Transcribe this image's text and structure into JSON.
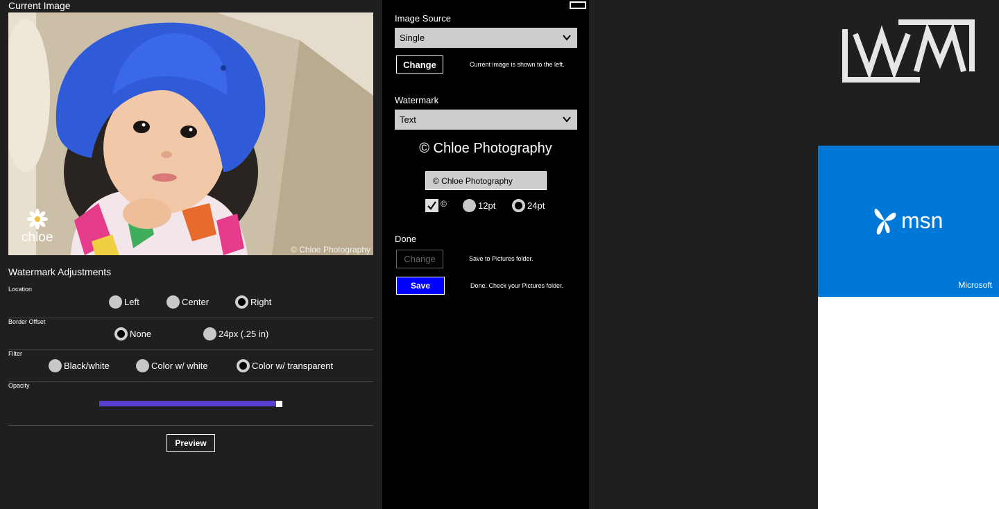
{
  "current_image": {
    "title": "Current Image",
    "photo_logo_text": "chloe",
    "photo_watermark": "© Chloe Photography"
  },
  "adjustments": {
    "title": "Watermark Adjustments",
    "location": {
      "label": "Location",
      "options": [
        "Left",
        "Center",
        "Right"
      ],
      "selected": "Right"
    },
    "border_offset": {
      "label": "Border Offset",
      "options": [
        "None",
        "24px (.25 in)"
      ],
      "selected": "None"
    },
    "filter": {
      "label": "Filter",
      "options": [
        "Black/white",
        "Color w/ white",
        "Color w/ transparent"
      ],
      "selected": "Color w/ transparent"
    },
    "opacity": {
      "label": "Opacity",
      "value": 1.0
    },
    "preview_label": "Preview"
  },
  "image_source": {
    "label": "Image Source",
    "selected": "Single",
    "change_label": "Change",
    "note": "Current image is shown to the left."
  },
  "watermark": {
    "label": "Watermark",
    "selected": "Text",
    "preview_text": "© Chloe Photography",
    "text_value": "© Chloe Photography",
    "copyright_checked": true,
    "copyright_label": "©",
    "size_options": [
      "12pt",
      "24pt"
    ],
    "size_selected": "24pt"
  },
  "done": {
    "label": "Done",
    "change_label": "Change",
    "change_note": "Save to Pictures folder.",
    "save_label": "Save",
    "save_note": "Done.  Check your Pictures folder."
  },
  "tiles": {
    "msn_text": "msn",
    "microsoft_label": "Microsoft"
  },
  "colors": {
    "pane_bg": "#1f1f1f",
    "mid_bg": "#000000",
    "slider": "#5b3fd1",
    "save_btn": "#0000ff",
    "msn_tile": "#0078d7"
  }
}
